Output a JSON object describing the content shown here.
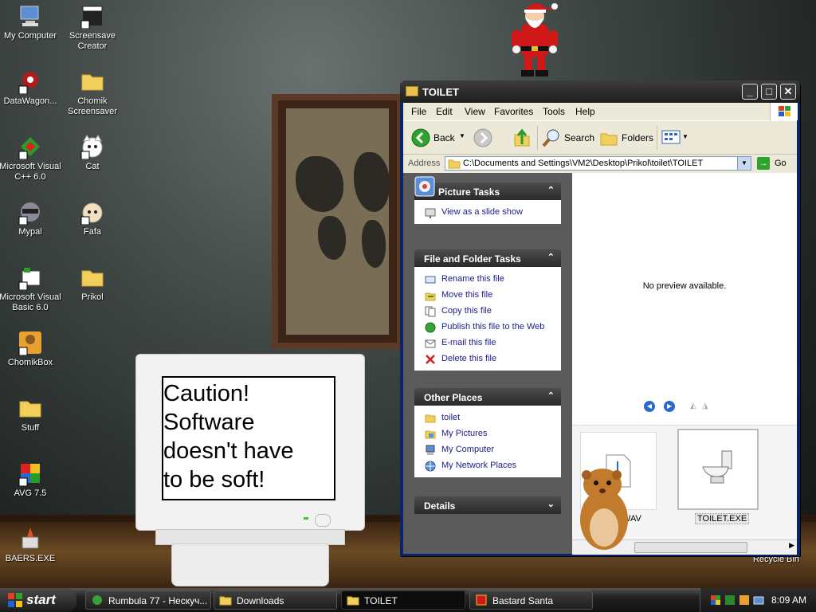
{
  "desktop": {
    "icons": [
      {
        "label": "My Computer"
      },
      {
        "label": "Screensave Creator"
      },
      {
        "label": "DataWagon..."
      },
      {
        "label": "Chomik Screensaver"
      },
      {
        "label": "Microsoft Visual C++ 6.0"
      },
      {
        "label": "Cat"
      },
      {
        "label": "Mypal"
      },
      {
        "label": "Fafa"
      },
      {
        "label": "Microsoft Visual Basic 6.0"
      },
      {
        "label": "Prikol"
      },
      {
        "label": "ChomikBox"
      },
      {
        "label": "Stuff"
      },
      {
        "label": "AVG 7.5"
      },
      {
        "label": "BAERS.EXE"
      },
      {
        "label": "Recycle Bin"
      }
    ],
    "monitor_text": [
      "Caution!",
      "Software",
      "doesn't have",
      "to be soft!"
    ]
  },
  "window": {
    "title": "TOILET",
    "menu": [
      "File",
      "Edit",
      "View",
      "Favorites",
      "Tools",
      "Help"
    ],
    "toolbar": {
      "back": "Back",
      "search": "Search",
      "folders": "Folders"
    },
    "address": {
      "label": "Address",
      "value": "C:\\Documents and Settings\\VM2\\Desktop\\Prikol\\toilet\\TOILET",
      "go": "Go"
    },
    "picture_tasks": {
      "title": "Picture Tasks",
      "items": [
        "View as a slide show"
      ]
    },
    "file_tasks": {
      "title": "File and Folder Tasks",
      "items": [
        "Rename this file",
        "Move this file",
        "Copy this file",
        "Publish this file to the Web",
        "E-mail this file",
        "Delete this file"
      ]
    },
    "other_places": {
      "title": "Other Places",
      "items": [
        "toilet",
        "My Pictures",
        "My Computer",
        "My Network Places"
      ]
    },
    "details": {
      "title": "Details"
    },
    "preview": {
      "message": "No preview available."
    },
    "thumbnails": [
      {
        "label": "WAV",
        "type": "wav"
      },
      {
        "label": "TOILET.EXE",
        "type": "exe",
        "selected": true
      }
    ]
  },
  "taskbar": {
    "start": "start",
    "tasks": [
      {
        "label": "Rumbula 77 - Нескуч..."
      },
      {
        "label": "Downloads"
      },
      {
        "label": "TOILET",
        "active": true
      },
      {
        "label": "Bastard Santa"
      }
    ],
    "clock": "8:09 AM"
  },
  "colors": {
    "taskbar": "#222222",
    "task_link": "#1c1c8c",
    "title_bar": "#2a2a2a"
  }
}
